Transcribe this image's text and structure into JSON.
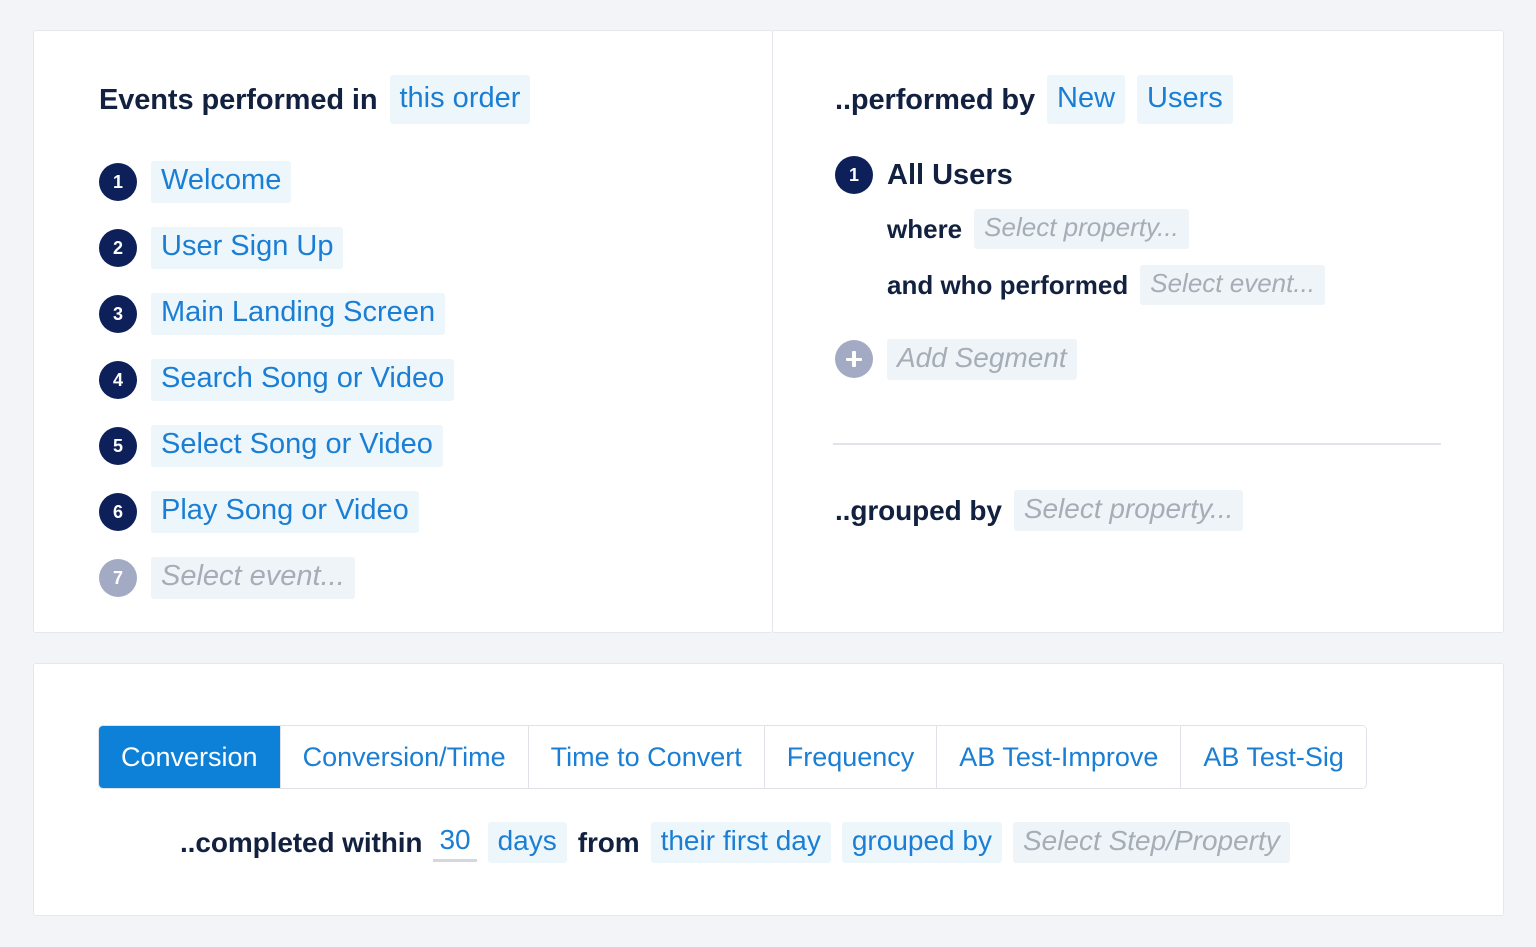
{
  "events_panel": {
    "header_label": "Events performed in",
    "header_value": "this order",
    "steps": [
      {
        "num": "1",
        "label": "Welcome",
        "placeholder": false
      },
      {
        "num": "2",
        "label": "User Sign Up",
        "placeholder": false
      },
      {
        "num": "3",
        "label": "Main Landing Screen",
        "placeholder": false
      },
      {
        "num": "4",
        "label": "Search Song or Video",
        "placeholder": false
      },
      {
        "num": "5",
        "label": "Select Song or Video",
        "placeholder": false
      },
      {
        "num": "6",
        "label": "Play Song or Video",
        "placeholder": false
      },
      {
        "num": "7",
        "label": "Select event...",
        "placeholder": true
      }
    ]
  },
  "segments_panel": {
    "header_label": "..performed by",
    "header_value_1": "New",
    "header_value_2": "Users",
    "segment": {
      "num": "1",
      "title": "All Users",
      "where_label": "where",
      "where_placeholder": "Select property...",
      "performed_label": "and who performed",
      "performed_placeholder": "Select event..."
    },
    "add_segment_label": "Add Segment",
    "grouped_by_label": "..grouped by",
    "grouped_by_placeholder": "Select property..."
  },
  "bottom_panel": {
    "tabs": [
      {
        "label": "Conversion",
        "active": true
      },
      {
        "label": "Conversion/Time",
        "active": false
      },
      {
        "label": "Time to Convert",
        "active": false
      },
      {
        "label": "Frequency",
        "active": false
      },
      {
        "label": "AB Test-Improve",
        "active": false
      },
      {
        "label": "AB Test-Sig",
        "active": false
      }
    ],
    "sentence": {
      "prefix": "..completed within",
      "number": "30",
      "unit": "days",
      "connector": "from",
      "anchor": "their first day",
      "group_label": "grouped by",
      "group_placeholder": "Select Step/Property"
    }
  },
  "colors": {
    "navy": "#0d2059",
    "accent_blue": "#1a7fd4",
    "active_tab_blue": "#0d81d8",
    "chip_bg": "#edf6fb",
    "muted_badge": "#a3abc4",
    "page_bg": "#f2f4f7"
  }
}
